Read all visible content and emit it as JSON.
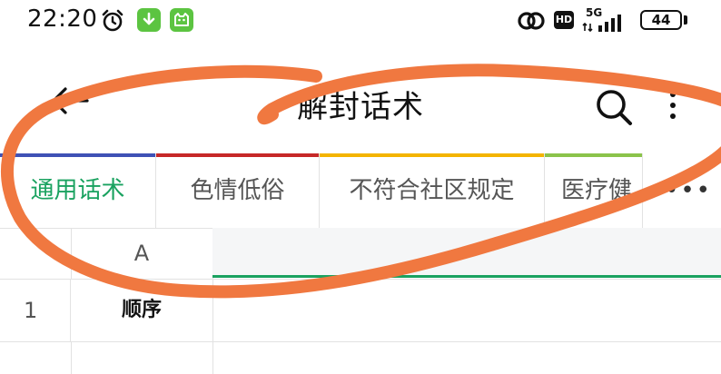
{
  "status_bar": {
    "time": "22:20",
    "network": "5G",
    "hd_label": "HD",
    "battery": "44",
    "icons": [
      "alarm-icon",
      "download-icon",
      "app-cat-icon",
      "link-icon",
      "signal-icon",
      "battery-icon"
    ]
  },
  "toolbar": {
    "title": "解封话术",
    "icons": [
      "back-arrow-icon",
      "search-icon",
      "more-vertical-icon"
    ]
  },
  "tabs": {
    "items": [
      {
        "label": "通用话术",
        "color": "#3f51b5",
        "active": true
      },
      {
        "label": "色情低俗",
        "color": "#c62828",
        "active": false
      },
      {
        "label": "不符合社区规定",
        "color": "#f4b400",
        "active": false
      },
      {
        "label": "医疗健",
        "color": "#8bc34a",
        "active": false
      }
    ],
    "more_label": "•••",
    "active_color": "#1aa260"
  },
  "grid": {
    "column_headers": [
      "A"
    ],
    "rows": [
      {
        "number": "1",
        "cells": [
          "顺序"
        ]
      }
    ]
  },
  "annotation": {
    "color": "#f07840"
  }
}
